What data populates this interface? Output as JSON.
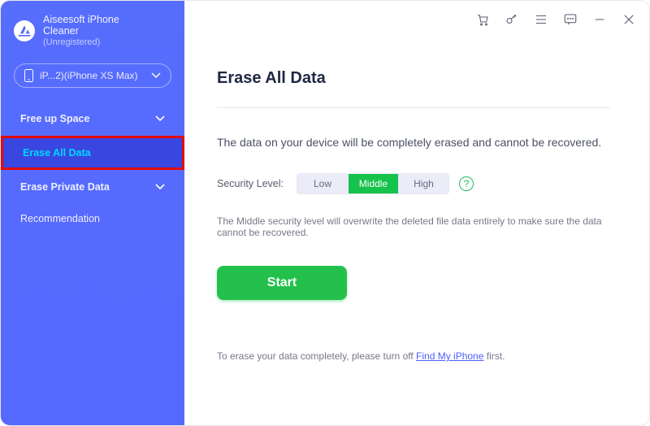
{
  "brand": {
    "line1": "Aiseesoft iPhone",
    "line2": "Cleaner",
    "status": "(Unregistered)"
  },
  "device": {
    "label": "iP...2)(iPhone XS Max)"
  },
  "sidebar": {
    "items": [
      {
        "label": "Free up Space"
      },
      {
        "label": "Erase All Data"
      },
      {
        "label": "Erase Private Data"
      },
      {
        "label": "Recommendation"
      }
    ]
  },
  "content": {
    "title": "Erase All Data",
    "subtitle": "The data on your device will be completely erased and cannot be recovered.",
    "securityLabel": "Security Level:",
    "levels": {
      "low": "Low",
      "middle": "Middle",
      "high": "High"
    },
    "securityDesc": "The Middle security level will overwrite the deleted file data entirely to make sure the data cannot be recovered.",
    "start": "Start",
    "footnotePrefix": "To erase your data completely, please turn off ",
    "footnoteLink": "Find My iPhone",
    "footnoteSuffix": " first."
  }
}
